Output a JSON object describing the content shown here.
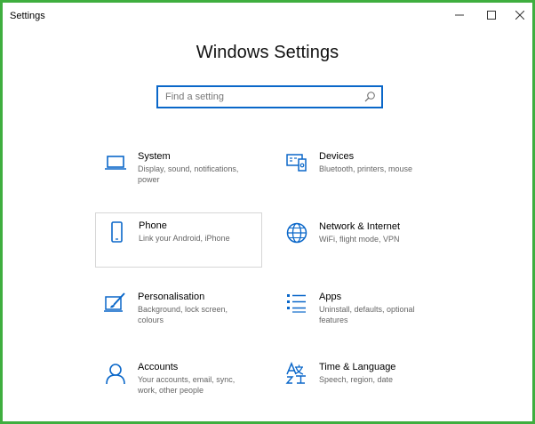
{
  "window": {
    "title": "Settings"
  },
  "heading": "Windows Settings",
  "search": {
    "placeholder": "Find a setting"
  },
  "tiles": [
    {
      "name": "System",
      "desc": "Display, sound, notifications, power",
      "icon": "laptop-icon"
    },
    {
      "name": "Devices",
      "desc": "Bluetooth, printers, mouse",
      "icon": "devices-icon"
    },
    {
      "name": "Phone",
      "desc": "Link your Android, iPhone",
      "icon": "phone-icon"
    },
    {
      "name": "Network & Internet",
      "desc": "WiFi, flight mode, VPN",
      "icon": "globe-icon"
    },
    {
      "name": "Personalisation",
      "desc": "Background, lock screen, colours",
      "icon": "paint-icon"
    },
    {
      "name": "Apps",
      "desc": "Uninstall, defaults, optional features",
      "icon": "apps-list-icon"
    },
    {
      "name": "Accounts",
      "desc": "Your accounts, email, sync, work, other people",
      "icon": "person-icon"
    },
    {
      "name": "Time & Language",
      "desc": "Speech, region, date",
      "icon": "time-language-icon"
    }
  ],
  "colors": {
    "accent": "#0a67c9",
    "frame": "#3fae3f",
    "description_text": "#666666"
  }
}
